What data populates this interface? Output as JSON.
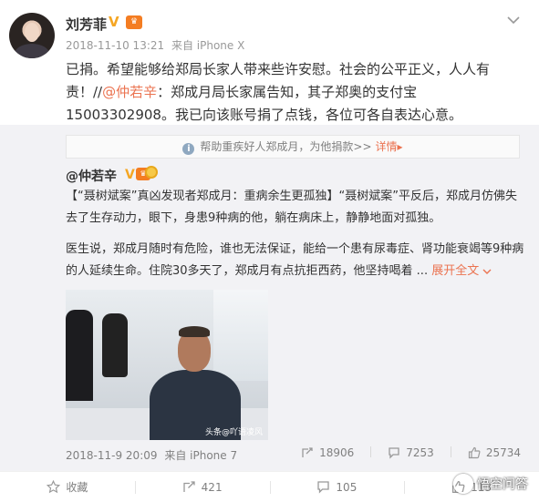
{
  "post": {
    "username": "刘芳菲",
    "verified_badge": "V",
    "vip_badge": "♛",
    "timestamp": "2018-11-10 13:21",
    "source": "来自 iPhone X",
    "text_before": "已捐。希望能够给郑局长家人带来些许安慰。社会的公平正义，人人有责！//",
    "mention": "@仲若辛",
    "text_after": "：郑成月局长家属告知，其子郑奥的支付宝15003302908。我已向该账号捐了点钱，各位可各自表达心意。"
  },
  "retweet": {
    "charity_text": "帮助重疾好人郑成月，为他捐款>>",
    "charity_detail": "详情",
    "charity_arrow": "▸",
    "author": "@仲若辛",
    "author_badge": "V",
    "author_vip": "♛",
    "paragraph1": "【“聂树斌案”真凶发现者郑成月：重病余生更孤独】“聂树斌案”平反后，郑成月仿佛失去了生存动力，眼下，身患9种病的他，躺在病床上，静静地面对孤独。",
    "paragraph2": "医生说，郑成月随时有危险，谁也无法保证，能给一个患有尿毒症、肾功能衰竭等9种病的人延续生命。住院30多天了，郑成月有点抗拒西药，他坚持喝着 ...",
    "expand_label": "展开全文",
    "photo_watermark": "头条@吖语凌风",
    "timestamp": "2018-11-9 20:09",
    "source": "来自 iPhone 7",
    "stats": {
      "reposts": "18906",
      "comments": "7253",
      "likes": "25734"
    }
  },
  "actions": {
    "favorite": "收藏",
    "repost": "421",
    "comment": "105",
    "like": "113"
  },
  "overlay_watermark": "悟空问答"
}
